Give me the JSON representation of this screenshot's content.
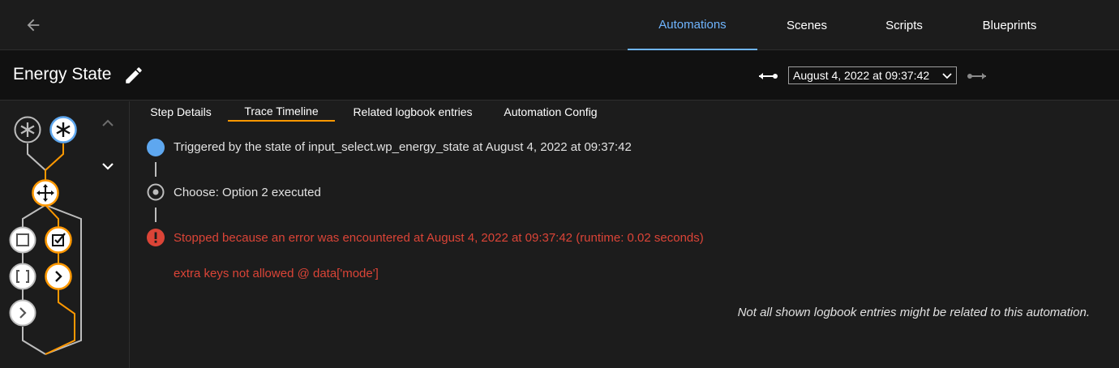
{
  "topbar": {
    "tabs": [
      {
        "label": "Automations",
        "active": true
      },
      {
        "label": "Scenes",
        "active": false
      },
      {
        "label": "Scripts",
        "active": false
      },
      {
        "label": "Blueprints",
        "active": false
      }
    ]
  },
  "header": {
    "title": "Energy State",
    "date_selected": "August 4, 2022 at 09:37:42"
  },
  "subtabs": [
    {
      "label": "Step Details",
      "active": false
    },
    {
      "label": "Trace Timeline",
      "active": true
    },
    {
      "label": "Related logbook entries",
      "active": false
    },
    {
      "label": "Automation Config",
      "active": false
    }
  ],
  "timeline": {
    "triggered": "Triggered by the state of input_select.wp_energy_state at August 4, 2022 at 09:37:42",
    "choose": "Choose: Option 2 executed",
    "error": "Stopped because an error was encountered at August 4, 2022 at 09:37:42 (runtime: 0.02 seconds)",
    "error_detail": "extra keys not allowed @ data['mode']",
    "note": "Not all shown logbook entries might be related to this automation."
  },
  "icons": {
    "back": "arrow-left-icon",
    "edit": "pencil-icon",
    "prev": "arrow-left-bar-icon",
    "next": "arrow-right-bar-icon",
    "scroll_up": "chevron-up-icon",
    "scroll_down": "chevron-down-icon"
  },
  "colors": {
    "accent": "#6fb5ff",
    "active_path": "#ff9800",
    "error": "#db4437",
    "trigger_dot": "#5ea7ef"
  }
}
